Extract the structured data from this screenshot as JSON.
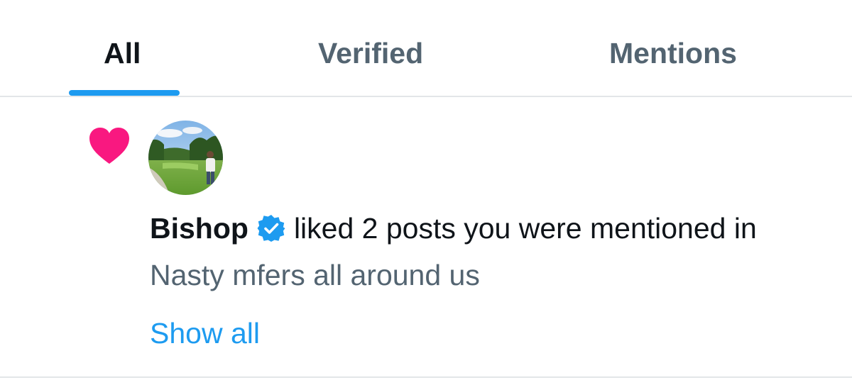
{
  "tabs": [
    {
      "label": "All",
      "active": true
    },
    {
      "label": "Verified",
      "active": false
    },
    {
      "label": "Mentions",
      "active": false
    }
  ],
  "notification": {
    "icon": "heart-icon",
    "user_name": "Bishop",
    "verified": true,
    "action_text": "liked 2 posts you were mentioned in",
    "post_text": "Nasty mfers all around us",
    "show_all_label": "Show all"
  },
  "colors": {
    "accent": "#1d9bf0",
    "like": "#f91880",
    "primary_text": "#0f1419",
    "secondary_text": "#536471",
    "divider": "#e3e6e8"
  }
}
